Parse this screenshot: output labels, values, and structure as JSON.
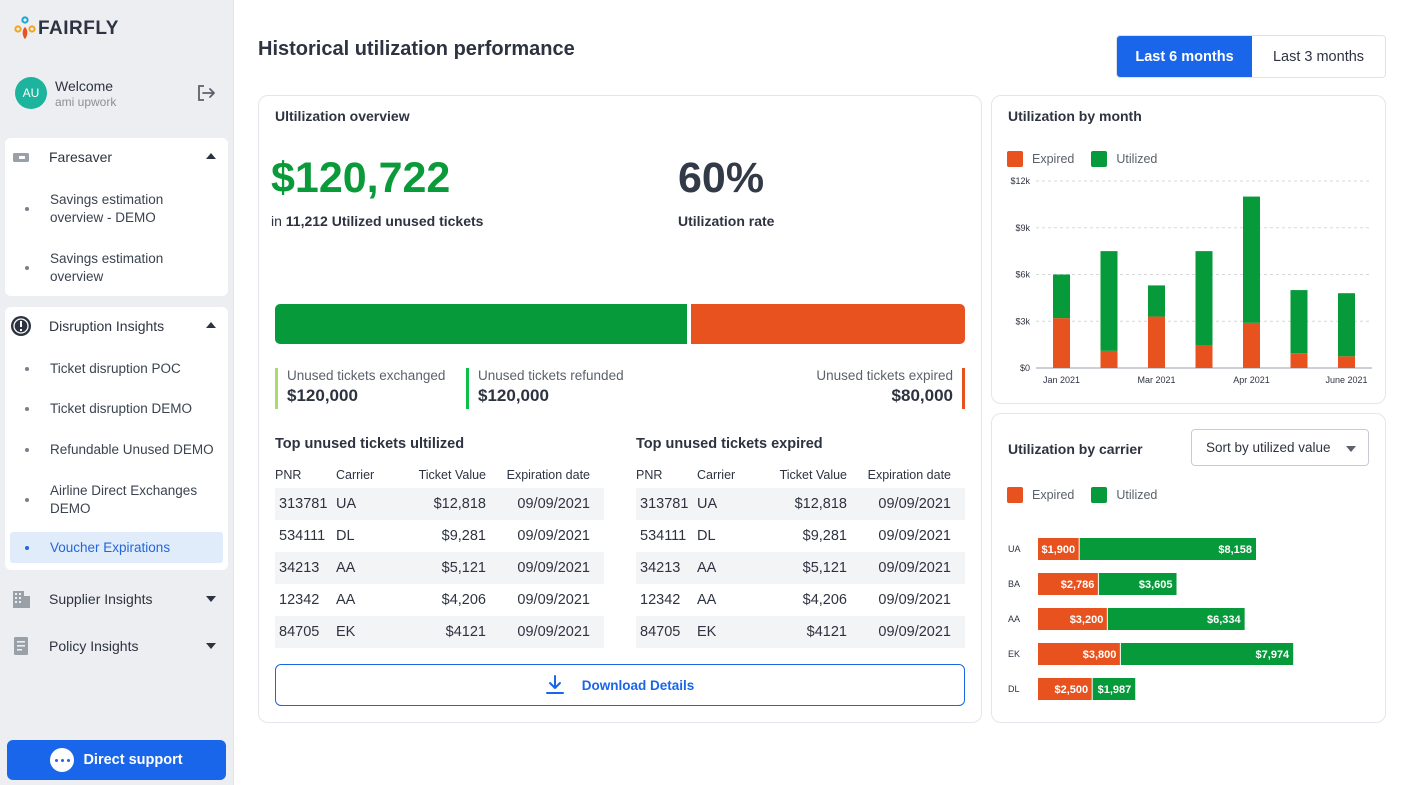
{
  "brand": {
    "logo_text": "FAIRFLY",
    "colors": {
      "primary": "#1a66ea",
      "utilized": "#079a3a",
      "expired": "#e8521e"
    }
  },
  "user": {
    "initials": "AU",
    "welcome": "Welcome",
    "name": "ami upwork"
  },
  "sidebar": {
    "faresaver": {
      "label": "Faresaver",
      "items": [
        "Savings estimation overview - DEMO",
        "Savings estimation overview"
      ]
    },
    "disruption": {
      "label": "Disruption Insights",
      "items": [
        "Ticket disruption POC",
        "Ticket disruption DEMO",
        "Refundable Unused DEMO",
        "Airline Direct Exchanges DEMO",
        "Voucher Expirations"
      ]
    },
    "supplier_label": "Supplier Insights",
    "policy_label": "Policy Insights",
    "support_label": "Direct support"
  },
  "header": {
    "title": "Historical utilization performance",
    "range_options": [
      "Last 6 months",
      "Last 3 months"
    ],
    "selected_range": "Last 6 months"
  },
  "overview": {
    "title": "Ultilization overview",
    "amount": "$120,722",
    "amount_prefix": "in",
    "amount_caption": "11,212 Utilized unused tickets",
    "rate": "60%",
    "rate_caption": "Utilization rate",
    "utilized_fraction": 0.6,
    "stats": [
      {
        "label": "Unused tickets exchanged",
        "value": "$120,000",
        "color": "#a9dc6b"
      },
      {
        "label": "Unused tickets refunded",
        "value": "$120,000",
        "color": "#0bbf4a"
      },
      {
        "label": "Unused tickets expired",
        "value": "$80,000",
        "color": "#e8521e"
      }
    ],
    "tables": {
      "columns": [
        "PNR",
        "Carrier",
        "Ticket Value",
        "Expiration date"
      ],
      "utilized_title": "Top unused tickets ultilized",
      "expired_title": "Top unused tickets expired",
      "utilized_rows": [
        [
          "313781",
          "UA",
          "$12,818",
          "09/09/2021"
        ],
        [
          "534111",
          "DL",
          "$9,281",
          "09/09/2021"
        ],
        [
          "34213",
          "AA",
          "$5,121",
          "09/09/2021"
        ],
        [
          "12342",
          "AA",
          "$4,206",
          "09/09/2021"
        ],
        [
          "84705",
          "EK",
          "$4121",
          "09/09/2021"
        ]
      ],
      "expired_rows": [
        [
          "313781",
          "UA",
          "$12,818",
          "09/09/2021"
        ],
        [
          "534111",
          "DL",
          "$9,281",
          "09/09/2021"
        ],
        [
          "34213",
          "AA",
          "$5,121",
          "09/09/2021"
        ],
        [
          "12342",
          "AA",
          "$4,206",
          "09/09/2021"
        ],
        [
          "84705",
          "EK",
          "$4121",
          "09/09/2021"
        ]
      ]
    },
    "download_label": "Download Details"
  },
  "legend": {
    "expired": "Expired",
    "utilized": "Utilized"
  },
  "month_card": {
    "title": "Utilization by month"
  },
  "carrier_card": {
    "title": "Utilization by carrier",
    "sort_label": "Sort by utilized value"
  },
  "chart_data": [
    {
      "type": "bar",
      "stacked": true,
      "title": "Utilization by month",
      "x_tick_labels": [
        "Jan 2021",
        "Mar 2021",
        "Apr 2021",
        "June 2021"
      ],
      "y_ticks": [
        "$0",
        "$3k",
        "$6k",
        "$9k",
        "$12k"
      ],
      "ylim": [
        0,
        12000
      ],
      "grid": true,
      "legend_position": "top-left",
      "bars": [
        {
          "expired": 3200,
          "utilized": 2800
        },
        {
          "expired": 1100,
          "utilized": 6400
        },
        {
          "expired": 3300,
          "utilized": 2000
        },
        {
          "expired": 1450,
          "utilized": 6050
        },
        {
          "expired": 2900,
          "utilized": 8100
        },
        {
          "expired": 950,
          "utilized": 4050
        },
        {
          "expired": 750,
          "utilized": 4050
        }
      ],
      "series": [
        {
          "name": "Expired",
          "color": "#e8521e"
        },
        {
          "name": "Utilized",
          "color": "#079a3a"
        }
      ]
    },
    {
      "type": "bar",
      "orientation": "horizontal",
      "stacked": true,
      "title": "Utilization by carrier",
      "categories": [
        "UA",
        "BA",
        "AA",
        "EK",
        "DL"
      ],
      "legend_position": "top-left",
      "series": [
        {
          "name": "Expired",
          "color": "#e8521e",
          "values": [
            1900,
            2786,
            3200,
            3800,
            2500
          ],
          "labels": [
            "$1,900",
            "$2,786",
            "$3,200",
            "$3,800",
            "$2,500"
          ]
        },
        {
          "name": "Utilized",
          "color": "#079a3a",
          "values": [
            8158,
            3605,
            6334,
            7974,
            1987
          ],
          "labels": [
            "$8,158",
            "$3,605",
            "$6,334",
            "$7,974",
            "$1,987"
          ]
        }
      ]
    }
  ]
}
